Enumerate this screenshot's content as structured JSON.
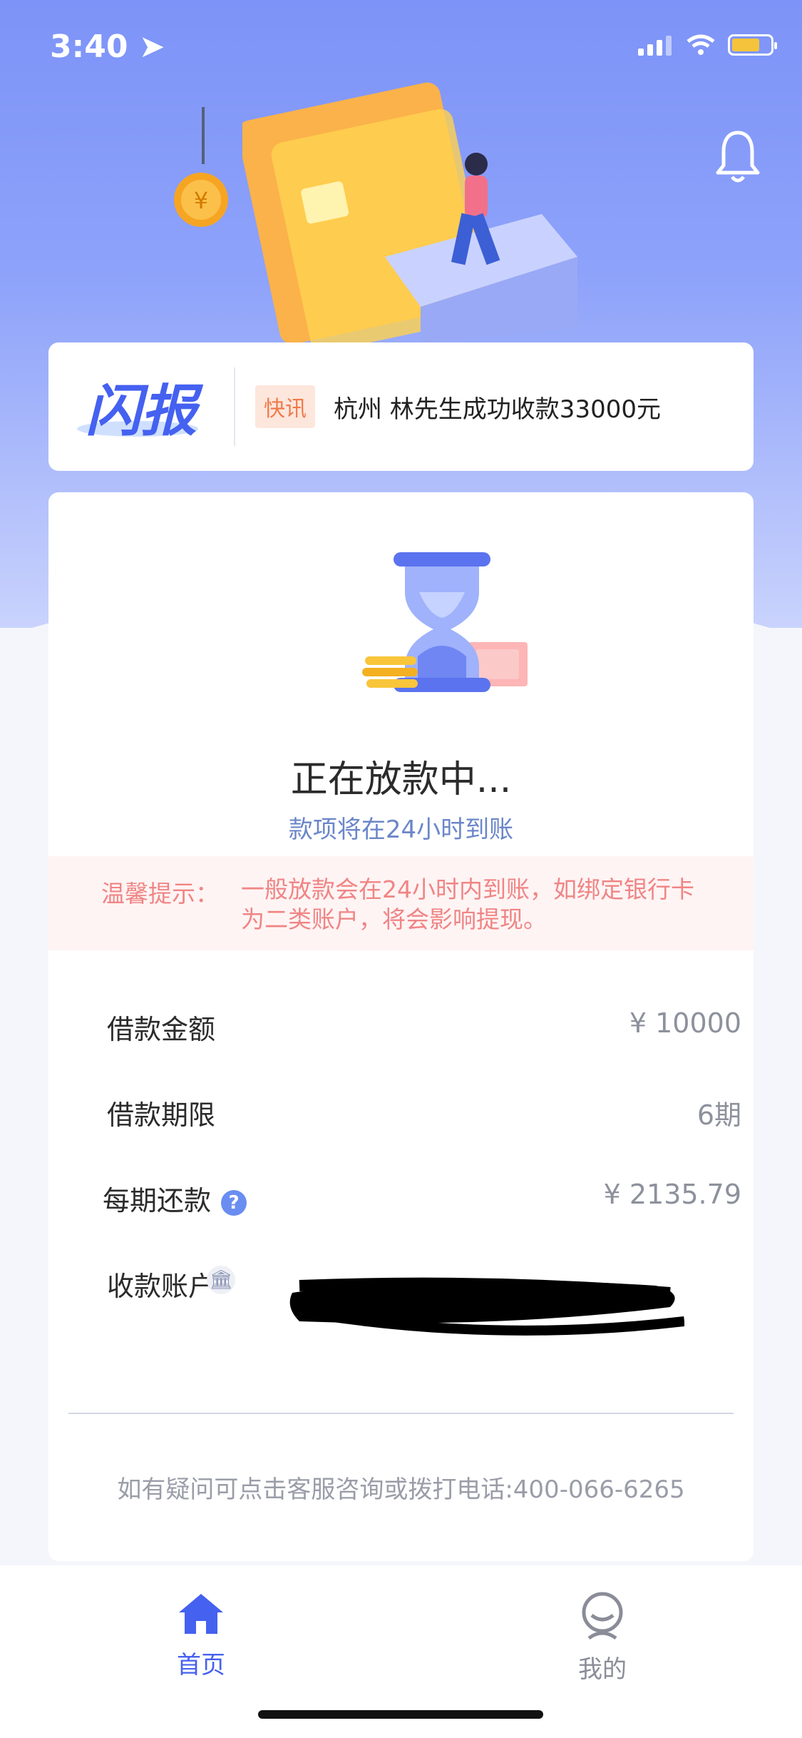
{
  "status_bar": {
    "time": "3:40"
  },
  "news": {
    "logo": "闪报",
    "tag": "快讯",
    "text": "杭州 林先生成功收款33000元"
  },
  "loan_status": {
    "title": "正在放款中...",
    "subtitle": "款项将在24小时到账",
    "tip_label": "温馨提示：",
    "tip_body": "一般放款会在24小时内到账，如绑定银行卡为二类账户，将会影响提现。"
  },
  "details": [
    {
      "label": "借款金额",
      "value": "¥ 10000"
    },
    {
      "label": "借款期限",
      "value": "6期"
    },
    {
      "label": "每期还款",
      "value": "¥ 2135.79"
    },
    {
      "label": "收款账户",
      "value": ""
    }
  ],
  "footer": {
    "contact": "如有疑问可点击客服咨询或拨打电话:400-066-6265"
  },
  "tabs": [
    {
      "label": "首页",
      "active": true
    },
    {
      "label": "我的",
      "active": false
    }
  ],
  "colors": {
    "accent": "#4561f0",
    "hero": "#7d93f7",
    "tip_text": "#f08585",
    "tip_bg": "#fff4f4"
  },
  "icons": [
    "location-arrow-icon",
    "signal-icon",
    "wifi-icon",
    "battery-icon",
    "bell-icon",
    "hourglass-icon",
    "help-icon",
    "bank-icon",
    "home-icon",
    "profile-icon"
  ]
}
